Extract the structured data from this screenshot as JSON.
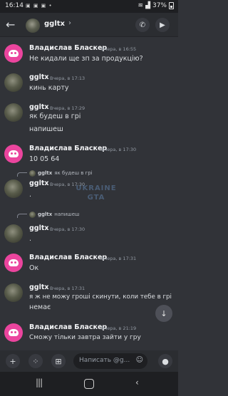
{
  "status_bar": {
    "time": "16:14",
    "battery": "37%"
  },
  "header": {
    "title": "ggltx",
    "chevron": "›"
  },
  "messages": [
    {
      "author": "Владислав Бласкер",
      "timestamp": "Вчера, в 16:55",
      "lines": [
        "Не кидали ще зп за продукцію?"
      ],
      "avatar": "discord"
    },
    {
      "author": "ggltx",
      "timestamp": "Вчера, в 17:13",
      "lines": [
        "кинь карту"
      ],
      "avatar": "photo"
    },
    {
      "author": "ggltx",
      "timestamp": "Вчера, в 17:29",
      "lines": [
        "як будеш в грі",
        "напишеш"
      ],
      "avatar": "photo"
    },
    {
      "author": "Владислав Бласкер",
      "timestamp": "Вчера, в 17:30",
      "lines": [
        "10 05 64"
      ],
      "avatar": "discord"
    },
    {
      "reply_to": {
        "author": "ggltx",
        "text": "як будеш в грі"
      },
      "author": "ggltx",
      "timestamp": "Вчера, в 17:30",
      "lines": [
        "."
      ],
      "avatar": "photo"
    },
    {
      "reply_to": {
        "author": "ggltx",
        "text": "напишеш"
      },
      "author": "ggltx",
      "timestamp": "Вчера, в 17:30",
      "lines": [
        "."
      ],
      "avatar": "photo"
    },
    {
      "author": "Владислав Бласкер",
      "timestamp": "Вчера, в 17:31",
      "lines": [
        "Ок"
      ],
      "avatar": "discord"
    },
    {
      "author": "ggltx",
      "timestamp": "Вчера, в 17:31",
      "lines": [
        "я ж не можу гроші скинути, коли тебе в грі",
        "немає"
      ],
      "avatar": "photo"
    },
    {
      "author": "Владислав Бласкер",
      "timestamp": "Вчера, в 21:19",
      "lines": [
        "Сможу тільки завтра зайти у гру"
      ],
      "avatar": "discord"
    }
  ],
  "watermark": {
    "line1": "UKRAINE",
    "line2": "GTA"
  },
  "composer": {
    "placeholder": "Написать @g..."
  },
  "colors": {
    "background": "#313338",
    "header": "#2b2d31",
    "discord_avatar": "#eb459e",
    "text": "#dbdee1",
    "muted": "#949ba4"
  }
}
